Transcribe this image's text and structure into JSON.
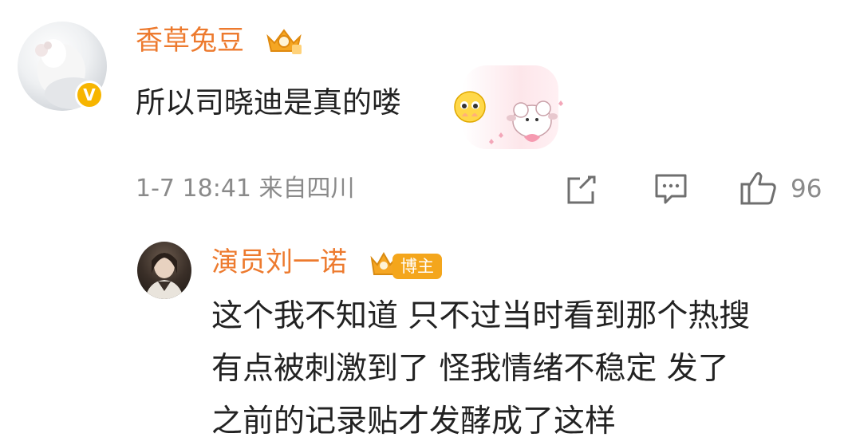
{
  "comment": {
    "username": "香草兔豆",
    "text": "所以司晓迪是真的喽",
    "verified_mark": "V",
    "emoji": "pleading-face-emoji",
    "meta": "1-7 18:41 来自四川",
    "like_count": "96"
  },
  "reply": {
    "username": "演员刘一诺",
    "badge": "博主",
    "lines": [
      "这个我不知道 只不过当时看到那个热搜",
      "有点被刺激到了 怪我情绪不稳定 发了",
      "之前的记录贴才发酵成了这样"
    ]
  },
  "colors": {
    "username": "#ed7a2e",
    "badge": "#f4a61c",
    "meta": "#8a8a8a",
    "text": "#222222"
  }
}
